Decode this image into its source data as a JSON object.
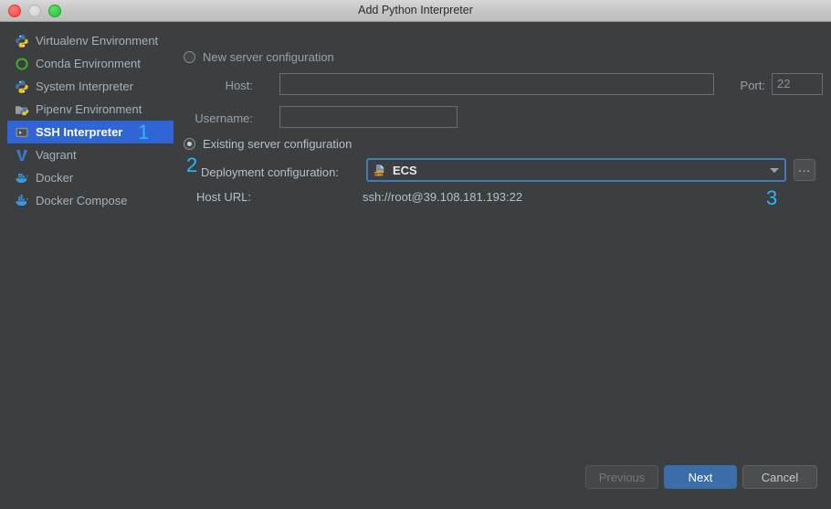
{
  "window": {
    "title": "Add Python Interpreter",
    "traffic_lights": [
      "close-button",
      "minimize-button",
      "zoom-button"
    ]
  },
  "sidebar": {
    "items": [
      {
        "label": "Virtualenv Environment",
        "icon": "python-virtualenv-icon",
        "selected": false
      },
      {
        "label": "Conda Environment",
        "icon": "conda-icon",
        "selected": false
      },
      {
        "label": "System Interpreter",
        "icon": "python-icon",
        "selected": false
      },
      {
        "label": "Pipenv Environment",
        "icon": "pipenv-icon",
        "selected": false
      },
      {
        "label": "SSH Interpreter",
        "icon": "ssh-terminal-icon",
        "selected": true
      },
      {
        "label": "Vagrant",
        "icon": "vagrant-icon",
        "selected": false
      },
      {
        "label": "Docker",
        "icon": "docker-icon",
        "selected": false
      },
      {
        "label": "Docker Compose",
        "icon": "docker-compose-icon",
        "selected": false
      }
    ]
  },
  "panel": {
    "new_server": {
      "radio_label": "New server configuration",
      "selected": false,
      "host_label": "Host:",
      "host_value": "",
      "host_placeholder": "",
      "port_label": "Port:",
      "port_value": "22",
      "username_label": "Username:",
      "username_value": "",
      "username_placeholder": ""
    },
    "existing_server": {
      "radio_label": "Existing server configuration",
      "selected": true,
      "deployment_label": "Deployment configuration:",
      "deployment_value": "ECS",
      "deployment_icon": "sftp-server-icon",
      "browse_label": "...",
      "host_url_label": "Host URL:",
      "host_url_value": "ssh://root@39.108.181.193:22"
    }
  },
  "annotations": [
    {
      "text": "1",
      "target": "sidebar-item-ssh-interpreter"
    },
    {
      "text": "2",
      "target": "deployment-configuration-label"
    },
    {
      "text": "3",
      "target": "deployment-configuration-combobox"
    }
  ],
  "footer": {
    "previous_label": "Previous",
    "next_label": "Next",
    "cancel_label": "Cancel"
  },
  "colors": {
    "background": "#3c3f41",
    "selection": "#2f65d4",
    "accent": "#3b6ea8",
    "annotation": "#29b6f6",
    "focus_ring": "#3f7cb8"
  }
}
